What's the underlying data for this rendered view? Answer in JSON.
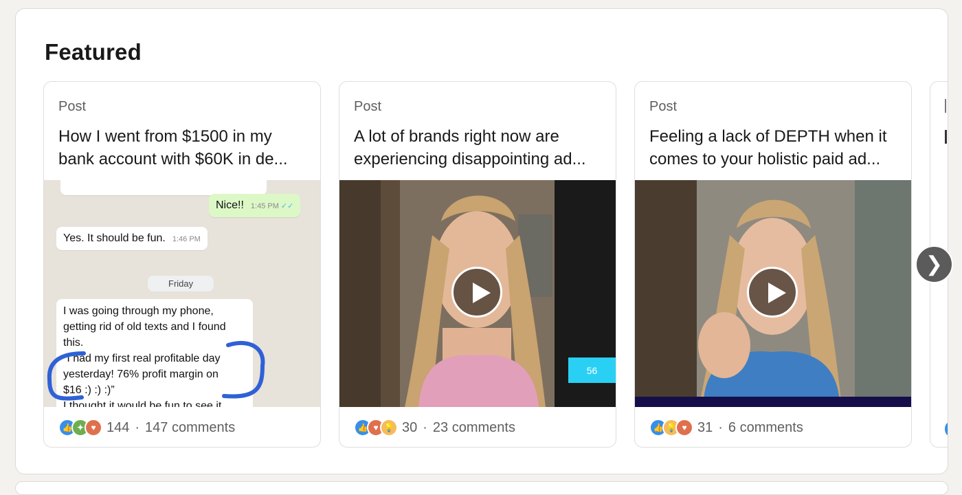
{
  "section": {
    "title": "Featured"
  },
  "cards": [
    {
      "type": "Post",
      "headline_line1": "How I went from $1500 in my",
      "headline_line2": "bank account with $60K in de...",
      "reactions_count": "144",
      "comments": "147 comments",
      "reaction_icons": [
        "like-icon",
        "celebrate-icon",
        "love-icon"
      ],
      "chat": {
        "msg_out": "Nice!!",
        "msg_out_time": "1:45 PM",
        "msg_in": "Yes. It should be fun.",
        "msg_in_time": "1:46 PM",
        "day": "Friday",
        "long_line1": "I was going through my phone,",
        "long_line2": "getting rid of old texts and I found",
        "long_line3": "this.",
        "long_line4": "“I had my first real profitable day",
        "long_line5": "yesterday! 76% profit margin on",
        "long_line6": "$16 :) :) :)”",
        "long_line7": "I thought it would be fun to see it"
      }
    },
    {
      "type": "Post",
      "headline_line1": "A lot of brands right now are",
      "headline_line2": "experiencing disappointing ad...",
      "reactions_count": "30",
      "comments": "23 comments",
      "reaction_icons": [
        "like-icon",
        "love-icon",
        "insightful-icon"
      ],
      "badge": "56"
    },
    {
      "type": "Post",
      "headline_line1": "Feeling a lack of DEPTH when it",
      "headline_line2": "comes to your holistic paid ad...",
      "reactions_count": "31",
      "comments": "6 comments",
      "reaction_icons": [
        "like-icon",
        "insightful-icon",
        "love-icon"
      ]
    }
  ],
  "nav": {
    "next_label": "❯"
  },
  "colors": {
    "accent": "#378fe9",
    "card_border": "#dedede"
  }
}
